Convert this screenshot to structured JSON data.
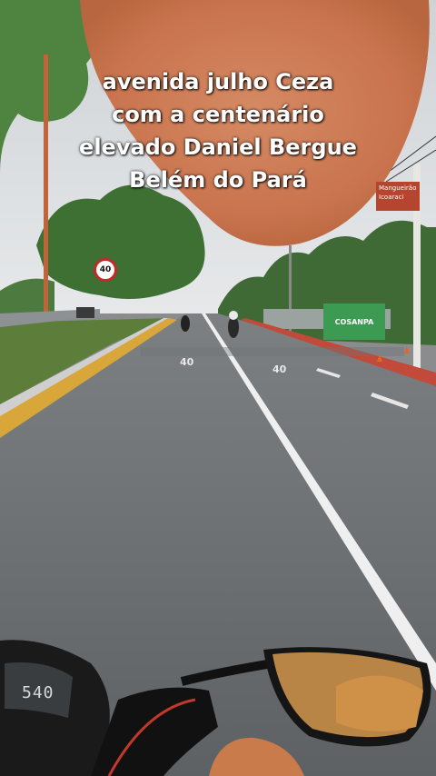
{
  "caption": {
    "line1": "avenida julho Ceza",
    "line2": "com a centenário",
    "line3": "elevado Daniel Bergue",
    "line4": "Belém do Pará"
  },
  "speed_sign": {
    "value": "40"
  },
  "road_markings": {
    "left": "40",
    "right": "40"
  },
  "direction_sign": {
    "line1": "Mangueirão",
    "line2": "Icoaraci"
  },
  "billboard": {
    "text": "COSANPA"
  },
  "speedometer": {
    "reading": "540"
  }
}
